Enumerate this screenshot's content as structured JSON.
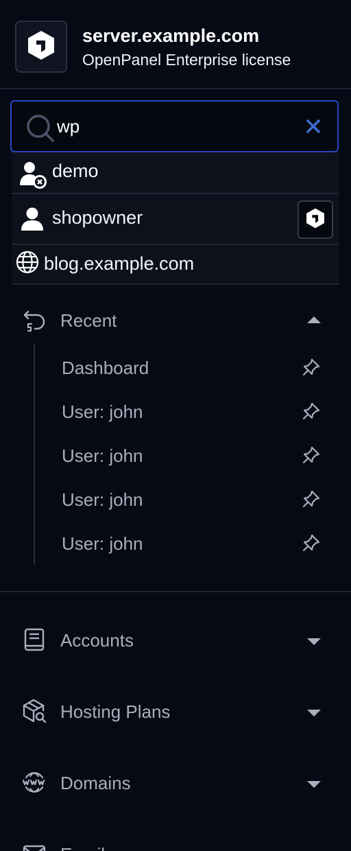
{
  "header": {
    "server_name": "server.example.com",
    "license": "OpenPanel Enterprise license",
    "logo_icon": "openpanel-cube-icon"
  },
  "search": {
    "value": "wp",
    "placeholder": "",
    "accent_color": "#2747c6"
  },
  "results": [
    {
      "label": "demo",
      "icon": "user-suspended-icon"
    },
    {
      "label": "shopowner",
      "icon": "user-icon",
      "badge_icon": "openpanel-cube-icon"
    },
    {
      "label": "blog.example.com",
      "icon": "globe-icon"
    }
  ],
  "recent": {
    "label": "Recent",
    "expanded": true,
    "items": [
      {
        "label": "Dashboard"
      },
      {
        "label": "User: john"
      },
      {
        "label": "User: john"
      },
      {
        "label": "User: john"
      },
      {
        "label": "User: john"
      }
    ]
  },
  "nav": [
    {
      "label": "Accounts",
      "icon": "book-icon"
    },
    {
      "label": "Hosting Plans",
      "icon": "package-search-icon"
    },
    {
      "label": "Domains",
      "icon": "www-globe-icon"
    },
    {
      "label": "Emails",
      "icon": "mail-icon"
    }
  ]
}
